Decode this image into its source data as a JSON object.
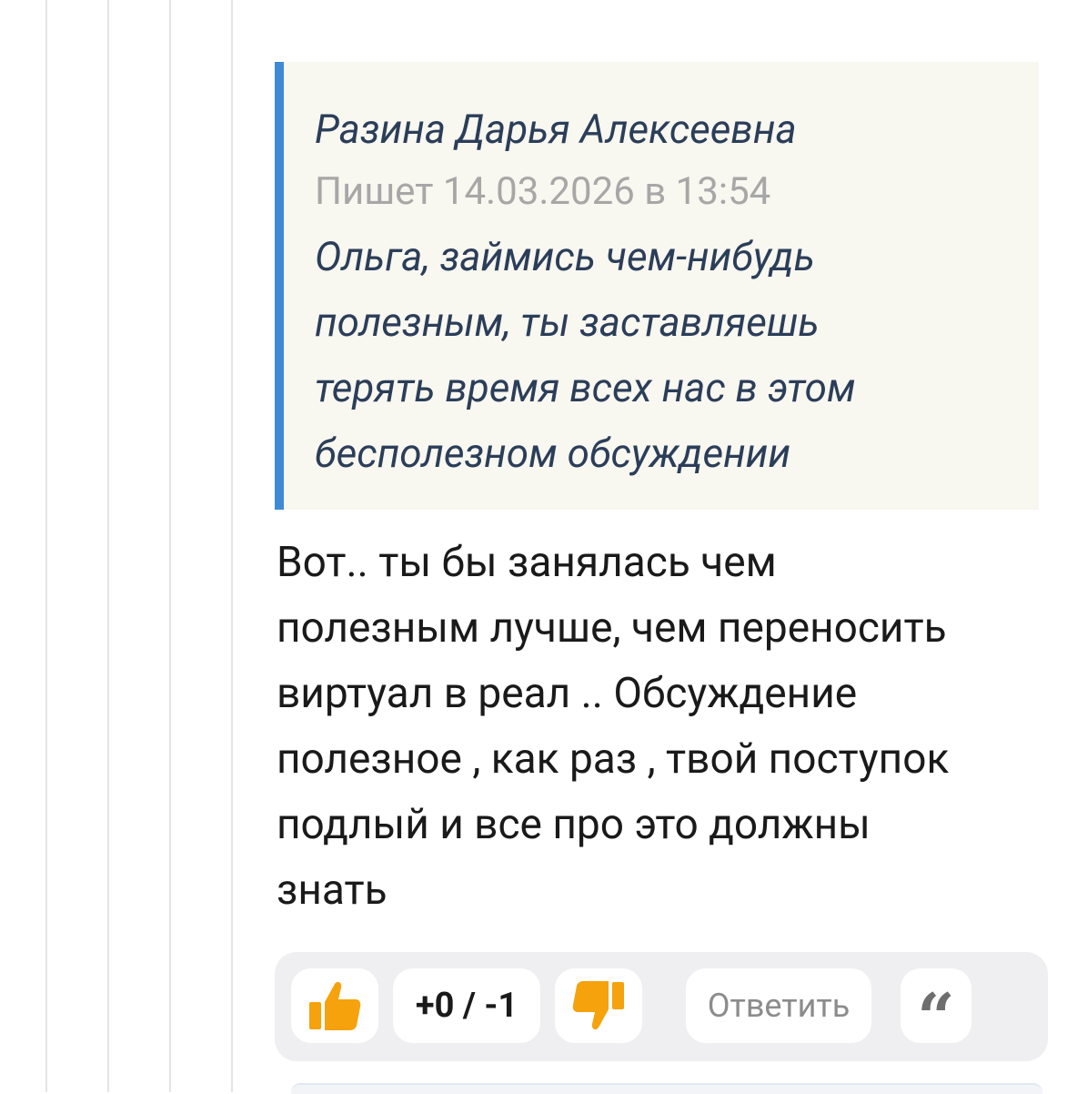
{
  "quote": {
    "author": "Разина Дарья Алексеевна",
    "meta": "Пишет 14.03.2026 в 13:54",
    "lines": [
      "Ольга, займись чем-нибудь",
      "полезным, ты заставляешь",
      "терять время всех нас в этом",
      "бесполезном обсуждении"
    ]
  },
  "comment": {
    "lines": [
      "Вот.. ты бы занялась чем",
      "полезным лучше, чем переносить",
      "виртуал в реал .. Обсуждение",
      "полезное , как раз , твой поступок",
      "подлый и все про это должны",
      "знать"
    ]
  },
  "actions": {
    "score": "+0 / -1",
    "reply_label": "Ответить",
    "quote_glyph": "“",
    "like_icon": "thumbs-up-icon",
    "dislike_icon": "thumbs-down-icon",
    "quote_icon": "quote-icon"
  },
  "colors": {
    "quote_border": "#3f8ad6",
    "quote_background": "#f8f7f0",
    "quote_text": "#2b3e59",
    "vote_icon": "#f5a20c",
    "action_bar": "#efeff1"
  }
}
